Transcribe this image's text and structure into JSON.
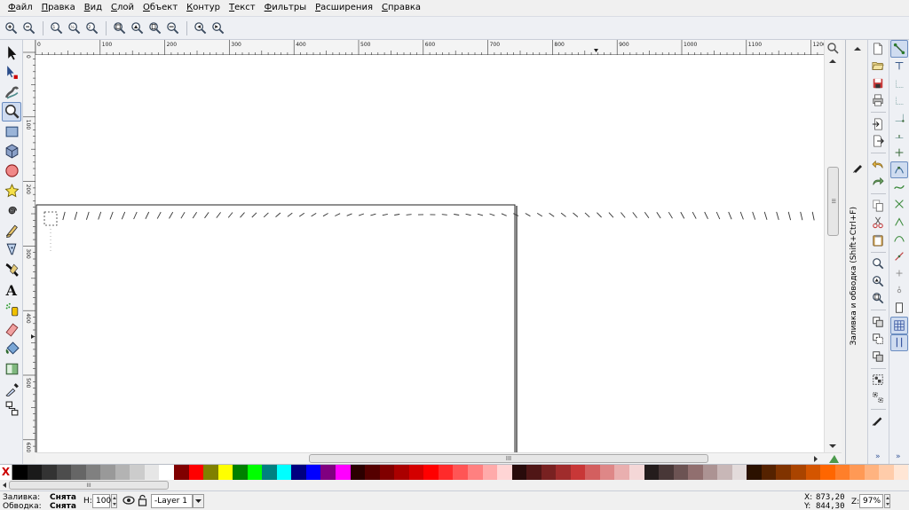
{
  "menu": {
    "items": [
      {
        "label": "Файл",
        "ul": "Ф",
        "rest": "айл"
      },
      {
        "label": "Правка",
        "ul": "П",
        "rest": "равка"
      },
      {
        "label": "Вид",
        "ul": "В",
        "rest": "ид"
      },
      {
        "label": "Слой",
        "ul": "С",
        "rest": "лой"
      },
      {
        "label": "Объект",
        "ul": "О",
        "rest": "бъект"
      },
      {
        "label": "Контур",
        "ul": "К",
        "rest": "онтур"
      },
      {
        "label": "Текст",
        "ul": "Т",
        "rest": "екст"
      },
      {
        "label": "Фильтры",
        "ul": "Ф",
        "rest": "ильтры"
      },
      {
        "label": "Расширения",
        "ul": "Р",
        "rest": "асширения"
      },
      {
        "label": "Справка",
        "ul": "С",
        "rest": "правка"
      }
    ]
  },
  "zoom_toolbar": {
    "buttons": [
      "zoom-in-icon",
      "zoom-out-icon",
      "zoom-1-1-icon",
      "zoom-1-2-icon",
      "zoom-2-1-icon",
      "zoom-selection-icon",
      "zoom-drawing-icon",
      "zoom-page-icon",
      "zoom-page-width-icon",
      "zoom-prev-icon",
      "zoom-next-icon"
    ]
  },
  "tools": [
    {
      "name": "selector-tool",
      "icon": "arrow-icon"
    },
    {
      "name": "node-tool",
      "icon": "node-arrow-icon"
    },
    {
      "name": "tweak-tool",
      "icon": "tweak-icon"
    },
    {
      "name": "zoom-tool",
      "icon": "magnifier-icon",
      "active": true
    },
    {
      "name": "rect-tool",
      "icon": "rectangle-icon"
    },
    {
      "name": "3dbox-tool",
      "icon": "box-3d-icon"
    },
    {
      "name": "ellipse-tool",
      "icon": "ellipse-icon"
    },
    {
      "name": "star-tool",
      "icon": "star-icon"
    },
    {
      "name": "spiral-tool",
      "icon": "spiral-icon"
    },
    {
      "name": "pencil-tool",
      "icon": "pencil-icon"
    },
    {
      "name": "pen-tool",
      "icon": "pen-icon"
    },
    {
      "name": "calligraphy-tool",
      "icon": "calligraphy-icon"
    },
    {
      "name": "text-tool",
      "icon": "text-icon"
    },
    {
      "name": "spray-tool",
      "icon": "spray-icon"
    },
    {
      "name": "eraser-tool",
      "icon": "eraser-icon"
    },
    {
      "name": "paint-bucket-tool",
      "icon": "bucket-icon"
    },
    {
      "name": "gradient-tool",
      "icon": "gradient-icon"
    },
    {
      "name": "dropper-tool",
      "icon": "dropper-icon"
    },
    {
      "name": "connector-tool",
      "icon": "connector-icon"
    }
  ],
  "ruler": {
    "h_labels": [
      "0",
      "100",
      "200",
      "300",
      "400",
      "500",
      "600",
      "700",
      "800",
      "900",
      "1000",
      "1100",
      "1200"
    ],
    "v_labels": [
      "0",
      "100",
      "200",
      "300",
      "400",
      "500",
      "600"
    ]
  },
  "dock": {
    "panel_title": "Заливка и обводка (Shift+Ctrl+F)"
  },
  "palette": {
    "none_label": "X",
    "colors": [
      "#000000",
      "#1a1a1a",
      "#333333",
      "#4d4d4d",
      "#666666",
      "#808080",
      "#999999",
      "#b3b3b3",
      "#cccccc",
      "#e6e6e6",
      "#ffffff",
      "#800000",
      "#ff0000",
      "#808000",
      "#ffff00",
      "#008000",
      "#00ff00",
      "#008080",
      "#00ffff",
      "#000080",
      "#0000ff",
      "#800080",
      "#ff00ff",
      "#2b0000",
      "#550000",
      "#800000",
      "#aa0000",
      "#d40000",
      "#ff0000",
      "#ff2a2a",
      "#ff5555",
      "#ff8080",
      "#ffaaaa",
      "#ffd5d5",
      "#280b0b",
      "#501616",
      "#782121",
      "#a02c2c",
      "#c83737",
      "#d35f5f",
      "#de8787",
      "#e9afaf",
      "#f4d7d7",
      "#241c1c",
      "#483737",
      "#6c5353",
      "#916f6f",
      "#ac9393",
      "#c8b7b7",
      "#e3dbdb",
      "#2b1100",
      "#552200",
      "#803300",
      "#aa4400",
      "#d45500",
      "#ff6600",
      "#ff7f2a",
      "#ff9955",
      "#ffb380",
      "#ffccaa",
      "#ffe6d5"
    ]
  },
  "status": {
    "fill_label": "Заливка:",
    "fill_value": "Снята",
    "stroke_label": "Обводка:",
    "stroke_value": "Снята",
    "h_label": "H:",
    "h_value": "100",
    "layer_value": "-Layer 1",
    "x_label": "X:",
    "x_value": "873,20",
    "y_label": "Y:",
    "y_value": "844,30",
    "z_label": "Z:",
    "z_value": "97%"
  },
  "scroll": {
    "h_grip": "III",
    "v_grip": "III",
    "dock_more": "»"
  }
}
